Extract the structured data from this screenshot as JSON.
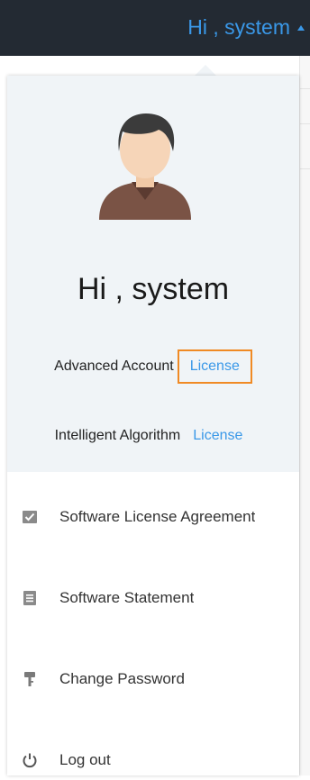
{
  "topbar": {
    "greeting": "Hi , system"
  },
  "profile": {
    "greeting": "Hi , system",
    "advanced_account_label": "Advanced Account",
    "advanced_account_link": "License",
    "intelligent_algorithm_label": "Intelligent Algorithm",
    "intelligent_algorithm_link": "License"
  },
  "menu": {
    "items": [
      {
        "label": "Software License Agreement",
        "icon": "license-agreement-icon"
      },
      {
        "label": "Software Statement",
        "icon": "statement-icon"
      },
      {
        "label": "Change Password",
        "icon": "key-icon"
      },
      {
        "label": "Log out",
        "icon": "power-icon"
      }
    ]
  },
  "colors": {
    "topbar_bg": "#232a33",
    "accent": "#3a98e8",
    "highlight_box": "#f08a24",
    "header_bg": "#f0f4f7"
  }
}
